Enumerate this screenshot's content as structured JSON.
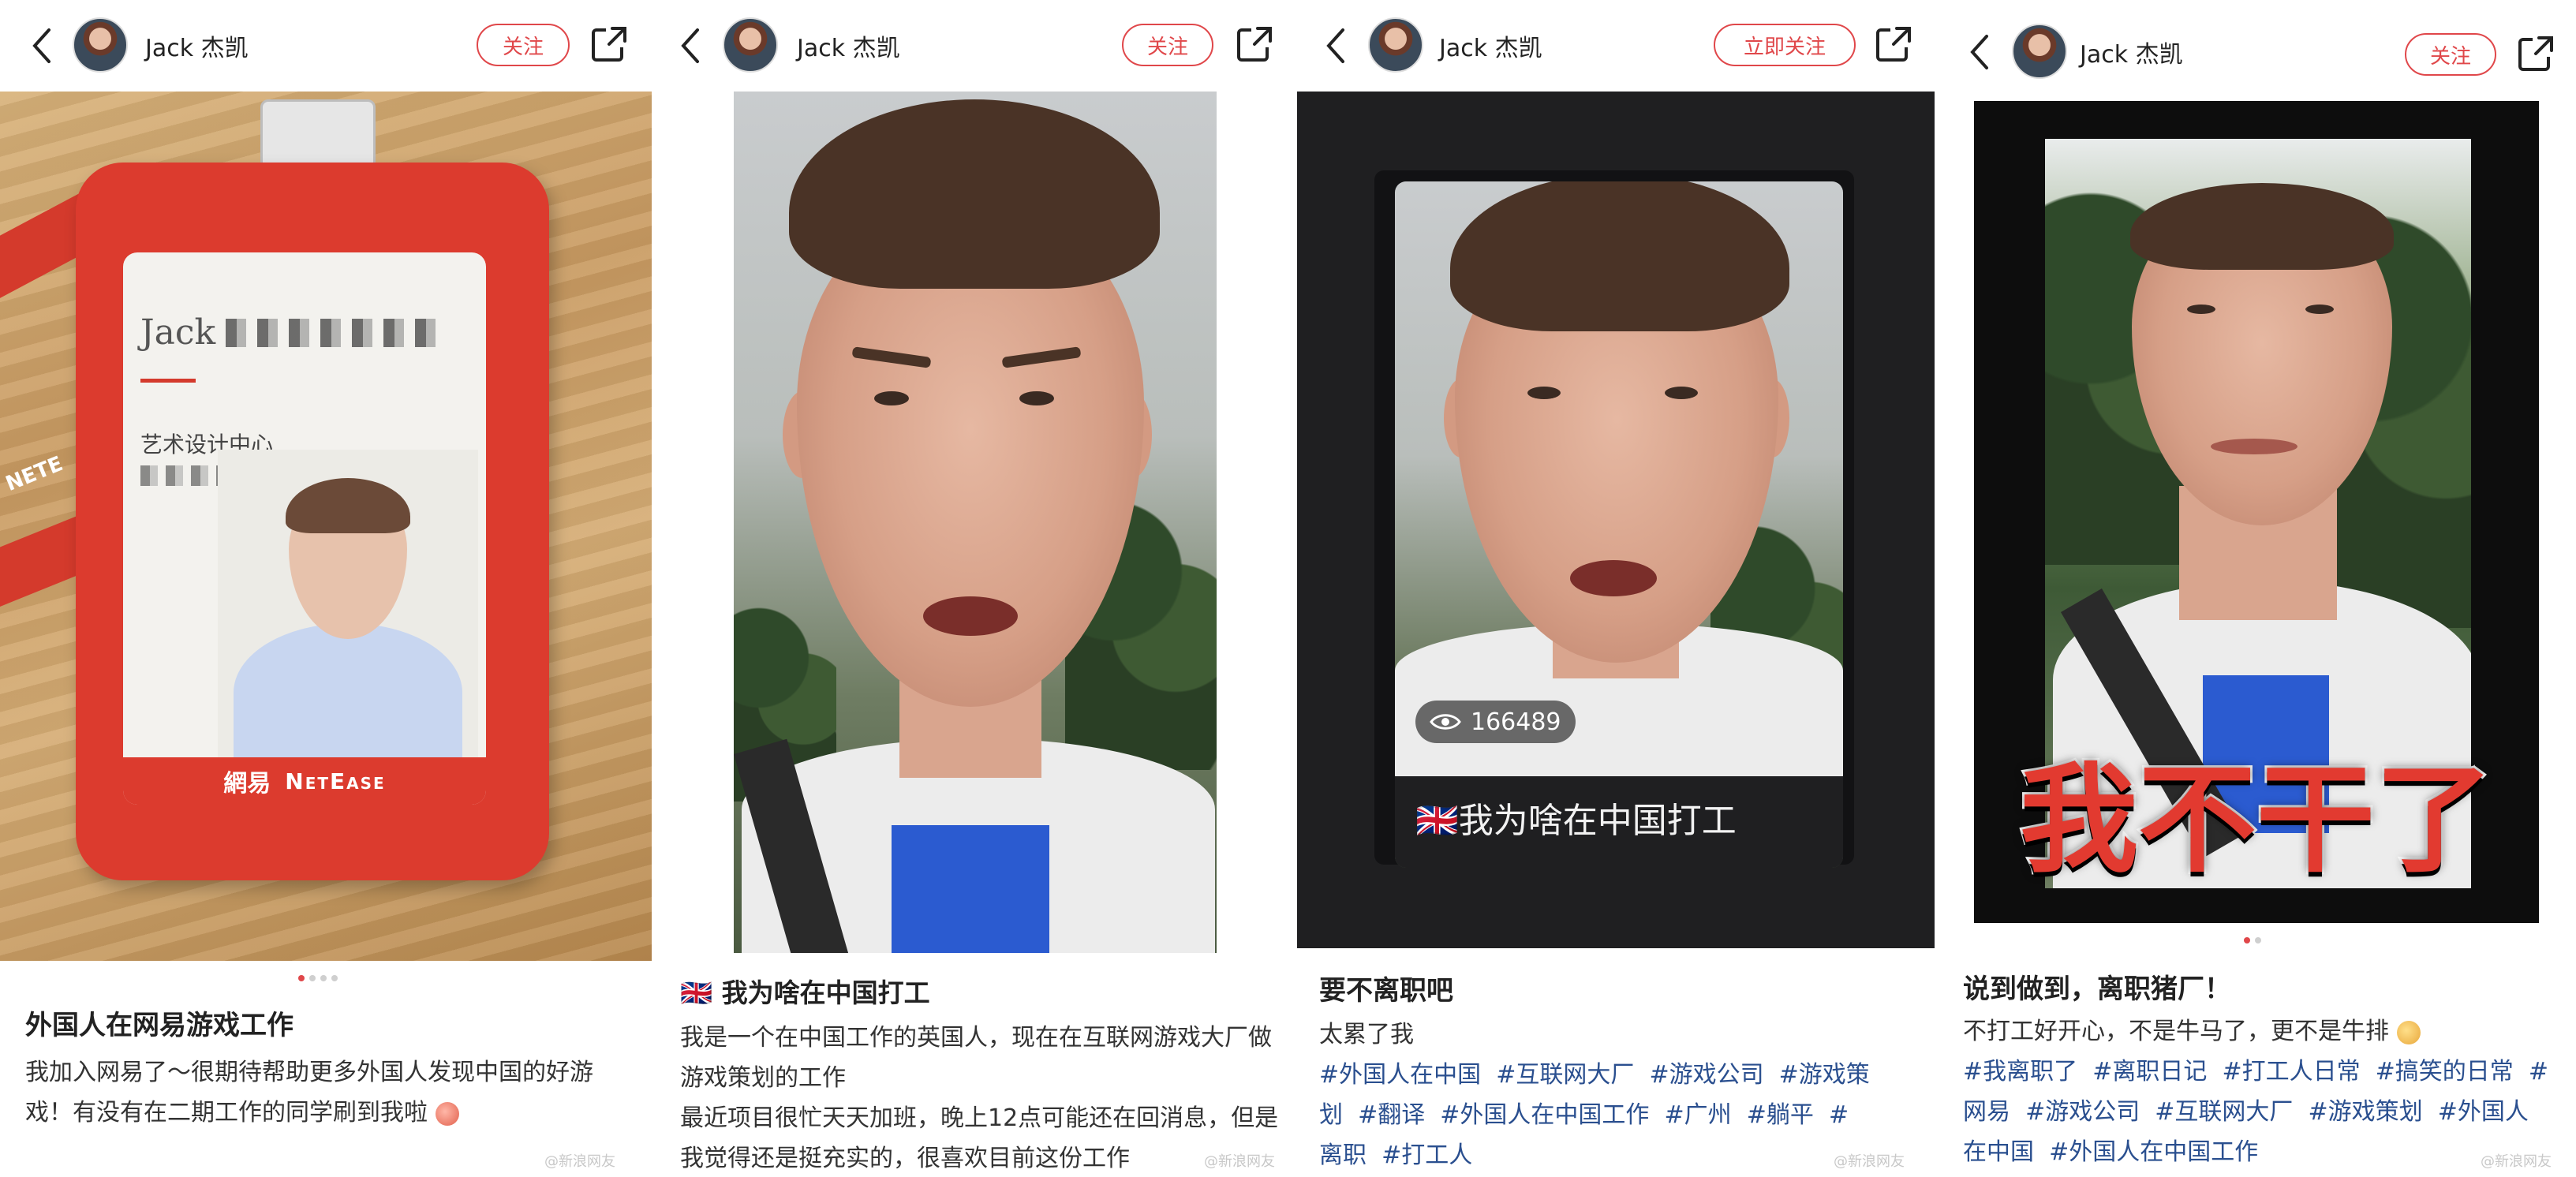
{
  "posts": [
    {
      "author": "Jack 杰凯",
      "follow_label": "关注",
      "badge": {
        "name_text": "Jack",
        "dept_text": "艺术设计中心",
        "brand_cn": "網易",
        "brand_en": "NetEase",
        "lanyard_text": "NETE"
      },
      "title": "外国人在网易游戏工作",
      "body": "我加入网易了～很期待帮助更多外国人发现中国的好游戏！有没有在二期工作的同学刷到我啦",
      "watermark": "@新浪网友"
    },
    {
      "author": "Jack 杰凯",
      "follow_label": "关注",
      "title": "🇬🇧 我为啥在中国打工",
      "body_lines": [
        "我是一个在中国工作的英国人，现在在互联网游戏大厂做游戏策划的工作",
        "最近项目很忙天天加班，晚上12点可能还在回消息，但是我觉得还是挺充实的，很喜欢目前这份工作"
      ],
      "watermark": "@新浪网友"
    },
    {
      "author": "Jack 杰凯",
      "follow_label": "立即关注",
      "views": "166489",
      "caption": "🇬🇧我为啥在中国打工",
      "title": "要不离职吧",
      "body": "太累了我",
      "tags": [
        "#外国人在中国",
        "#互联网大厂",
        "#游戏公司",
        "#游戏策划",
        "#翻译",
        "#外国人在中国工作",
        "#广州",
        "#躺平",
        "#离职",
        "#打工人"
      ],
      "watermark": "@新浪网友"
    },
    {
      "author": "Jack 杰凯",
      "follow_label": "关注",
      "overlay": "我不干了",
      "title": "说到做到，离职猪厂！",
      "body": "不打工好开心，不是牛马了，更不是牛排",
      "tags": [
        "#我离职了",
        "#离职日记",
        "#打工人日常",
        "#搞笑的日常",
        "#网易",
        "#游戏公司",
        "#互联网大厂",
        "#游戏策划",
        "#外国人在中国",
        "#外国人在中国工作"
      ],
      "watermark": "@新浪网友"
    }
  ],
  "colors": {
    "accent": "#e0474a",
    "tag": "#2a4f8f"
  }
}
